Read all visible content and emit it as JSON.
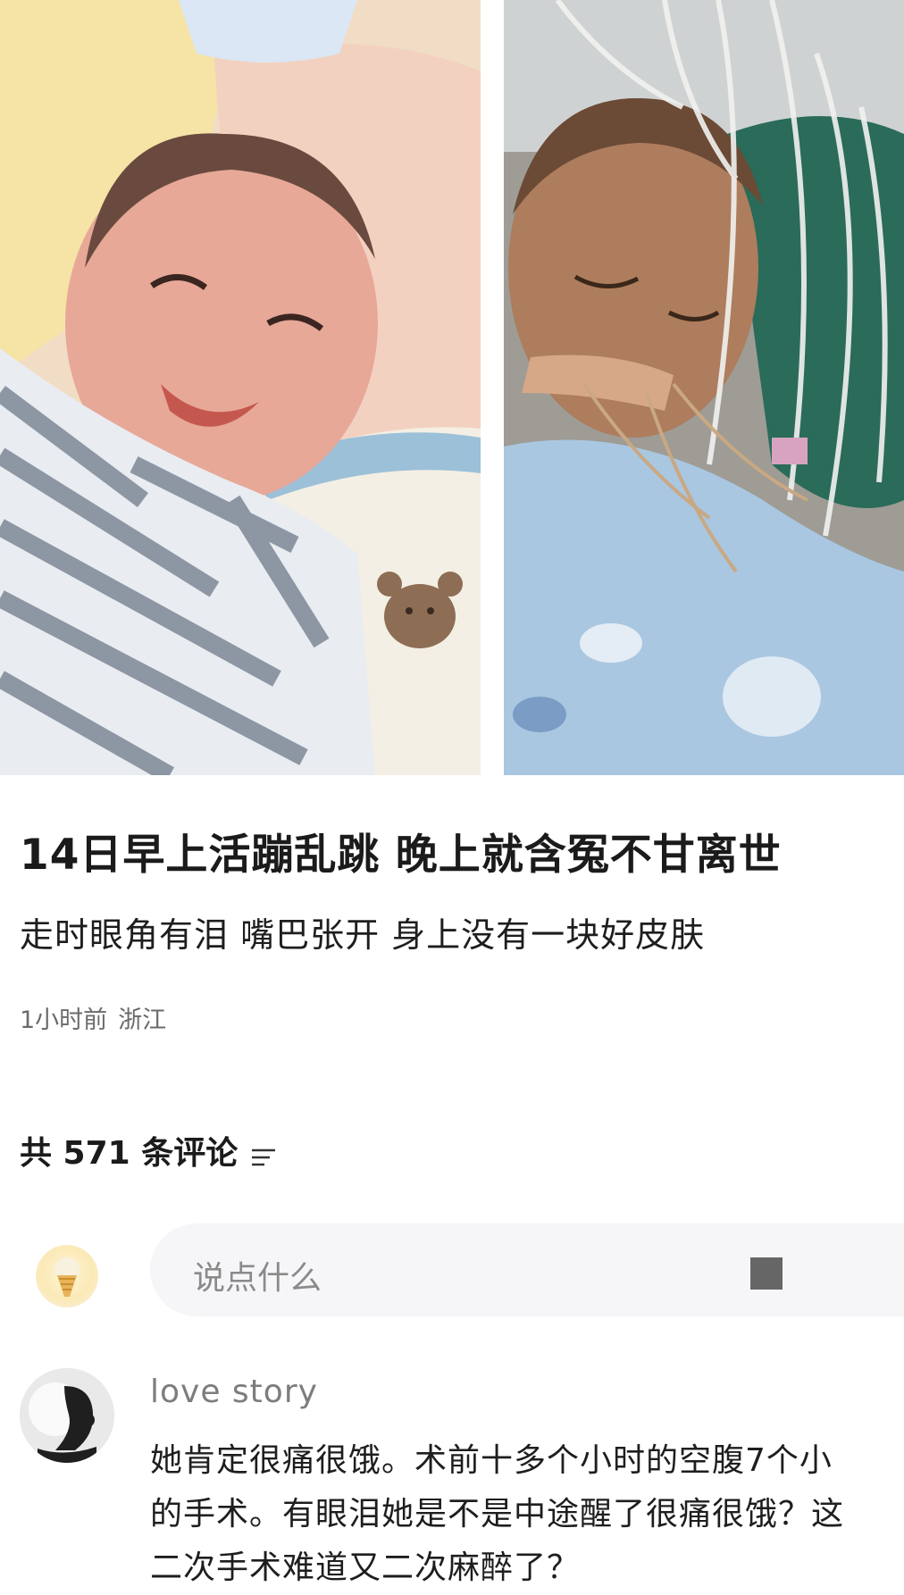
{
  "post": {
    "headline": "14日早上活蹦乱跳 晚上就含冤不甘离世",
    "subline": "走时眼角有泪 嘴巴张开 身上没有一块好皮肤",
    "time": "1小时前",
    "location": "浙江"
  },
  "comments_header": {
    "label": "共 571 条评论",
    "sort_icon": "sort-icon"
  },
  "compose": {
    "placeholder": "说点什么",
    "emoji_icon": "emoji-icon"
  },
  "comments": [
    {
      "username": "love story",
      "lines": [
        "她肯定很痛很饿。术前十多个小时的空腹7个小",
        "的手术。有眼泪她是不是中途醒了很痛很饿？这",
        "二次手术难道又二次麻醉了？"
      ]
    }
  ]
}
